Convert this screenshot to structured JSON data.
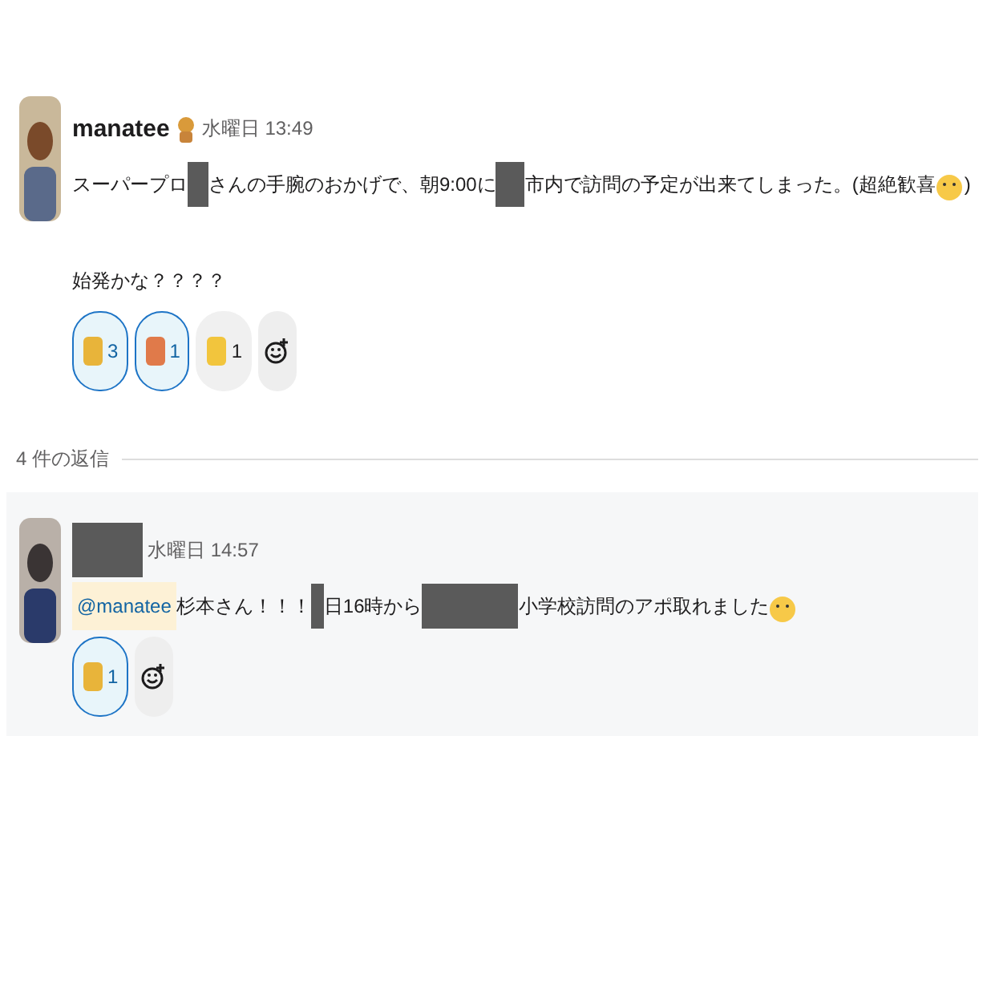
{
  "message": {
    "author": "manatee",
    "time": "水曜日 13:49",
    "paragraphs": [
      [
        {
          "kind": "text",
          "text": "スーパープロ"
        },
        {
          "kind": "redacted"
        },
        {
          "kind": "text",
          "text": "さんの手腕のおかげで、朝9:00に"
        },
        {
          "kind": "redacted"
        },
        {
          "kind": "text",
          "text": "市内で訪問の予定が出来てしまった。(超絶歓喜"
        },
        {
          "kind": "emoji"
        },
        {
          "kind": "text",
          "text": ")"
        }
      ],
      [
        {
          "kind": "text",
          "text": "始発かな？？？？"
        }
      ]
    ],
    "reactions": [
      {
        "count": "3",
        "selected": true
      },
      {
        "count": "1",
        "selected": true
      },
      {
        "count": "1",
        "selected": false
      }
    ]
  },
  "replies_label": "4 件の返信",
  "reply": {
    "time": "水曜日 14:57",
    "paragraphs": [
      [
        {
          "kind": "mention",
          "text": "@manatee"
        },
        {
          "kind": "text",
          "text": " 杉本さん！！！"
        },
        {
          "kind": "redacted"
        },
        {
          "kind": "text",
          "text": "日16時から"
        },
        {
          "kind": "redacted"
        },
        {
          "kind": "text",
          "text": "小学校訪問のアポ取れました"
        },
        {
          "kind": "emoji"
        }
      ]
    ],
    "reactions": [
      {
        "count": "1",
        "selected": true
      }
    ]
  }
}
